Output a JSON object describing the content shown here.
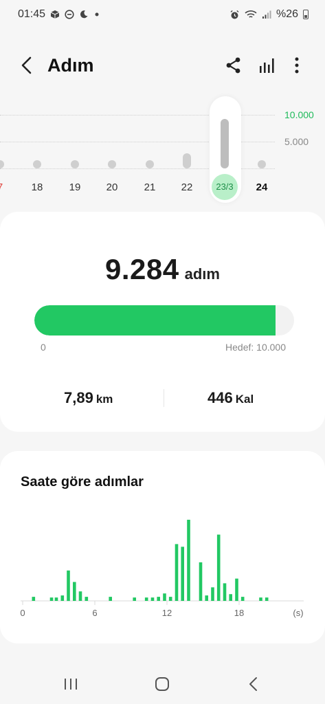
{
  "status": {
    "time": "01:45",
    "battery": "%26"
  },
  "header": {
    "title": "Adım"
  },
  "day_strip": {
    "goal_label": "10.000",
    "mid_label": "5.000",
    "days": [
      {
        "label": "7",
        "steps": 400,
        "style": "red"
      },
      {
        "label": "18",
        "steps": 500,
        "style": "normal"
      },
      {
        "label": "19",
        "steps": 450,
        "style": "normal"
      },
      {
        "label": "20",
        "steps": 450,
        "style": "normal"
      },
      {
        "label": "21",
        "steps": 600,
        "style": "normal"
      },
      {
        "label": "22",
        "steps": 2800,
        "style": "normal"
      },
      {
        "label": "23/3",
        "steps": 9284,
        "style": "selected"
      },
      {
        "label": "24",
        "steps": 400,
        "style": "bold"
      }
    ]
  },
  "steps_card": {
    "value": "9.284",
    "unit": "adım",
    "progress_fraction": 0.9284,
    "min_label": "0",
    "goal_label": "Hedef: 10.000",
    "distance_value": "7,89",
    "distance_unit": "km",
    "calories_value": "446",
    "calories_unit": "Kal"
  },
  "hourly_card": {
    "title": "Saate göre adımlar",
    "x_ticks": [
      "0",
      "6",
      "12",
      "18"
    ],
    "x_unit": "(s)"
  },
  "chart_data": {
    "type": "bar",
    "title": "Saate göre adımlar",
    "xlabel": "(s)",
    "ylabel": "",
    "xlim": [
      0,
      22
    ],
    "x_ticks": [
      0,
      6,
      12,
      18
    ],
    "ymax": 120,
    "bars": [
      {
        "x": 0.9,
        "y": 6
      },
      {
        "x": 2.4,
        "y": 5
      },
      {
        "x": 2.8,
        "y": 5
      },
      {
        "x": 3.3,
        "y": 8
      },
      {
        "x": 3.8,
        "y": 45
      },
      {
        "x": 4.3,
        "y": 28
      },
      {
        "x": 4.8,
        "y": 14
      },
      {
        "x": 5.3,
        "y": 6
      },
      {
        "x": 7.3,
        "y": 6
      },
      {
        "x": 9.3,
        "y": 5
      },
      {
        "x": 10.3,
        "y": 5
      },
      {
        "x": 10.8,
        "y": 5
      },
      {
        "x": 11.3,
        "y": 6
      },
      {
        "x": 11.8,
        "y": 11
      },
      {
        "x": 12.3,
        "y": 6
      },
      {
        "x": 12.8,
        "y": 84
      },
      {
        "x": 13.3,
        "y": 80
      },
      {
        "x": 13.8,
        "y": 120
      },
      {
        "x": 14.8,
        "y": 57
      },
      {
        "x": 15.3,
        "y": 8
      },
      {
        "x": 15.8,
        "y": 20
      },
      {
        "x": 16.3,
        "y": 98
      },
      {
        "x": 16.8,
        "y": 26
      },
      {
        "x": 17.3,
        "y": 10
      },
      {
        "x": 17.8,
        "y": 33
      },
      {
        "x": 18.3,
        "y": 6
      },
      {
        "x": 19.8,
        "y": 5
      },
      {
        "x": 20.3,
        "y": 5
      }
    ]
  },
  "colors": {
    "accent": "#22c863",
    "selected_day_bg": "#b9efc9",
    "selected_day_text": "#1f8f49",
    "weekend_red": "#e0443e",
    "bar_grey": "#cfcfcf"
  },
  "icons": {
    "back": "chevron-left-icon",
    "share": "share-icon",
    "stats": "bar-chart-icon",
    "more": "more-vertical-icon",
    "nav_recents": "recents-icon",
    "nav_home": "home-icon",
    "nav_back": "back-icon"
  }
}
